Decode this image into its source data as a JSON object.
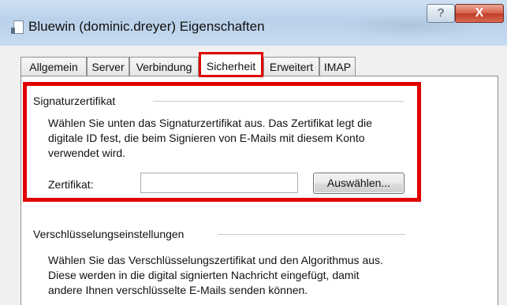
{
  "window": {
    "title": "Bluewin (dominic.dreyer) Eigenschaften",
    "help_label": "?",
    "close_label": "X"
  },
  "tabs": [
    {
      "label": "Allgemein",
      "active": false
    },
    {
      "label": "Server",
      "active": false
    },
    {
      "label": "Verbindung",
      "active": false
    },
    {
      "label": "Sicherheit",
      "active": true
    },
    {
      "label": "Erweitert",
      "active": false
    },
    {
      "label": "IMAP",
      "active": false
    }
  ],
  "signing": {
    "group_title": "Signaturzertifikat",
    "description_lines": [
      "Wählen Sie unten das Signaturzertifikat aus. Das Zertifikat legt die",
      "digitale ID fest, die beim Signieren von E-Mails mit diesem Konto",
      "verwendet wird."
    ],
    "certificate_label": "Zertifikat:",
    "certificate_value": "",
    "select_button": "Auswählen..."
  },
  "encryption": {
    "group_title": "Verschlüsselungseinstellungen",
    "description_lines": [
      "Wählen Sie das Verschlüsselungszertifikat und den Algorithmus aus.",
      "Diese werden in die digital signierten Nachricht eingefügt, damit",
      "andere Ihnen verschlüsselte E-Mails senden können."
    ]
  },
  "colors": {
    "highlight": "#e00000",
    "titlebar": "#b9d1ea",
    "close_button": "#c03a26"
  }
}
